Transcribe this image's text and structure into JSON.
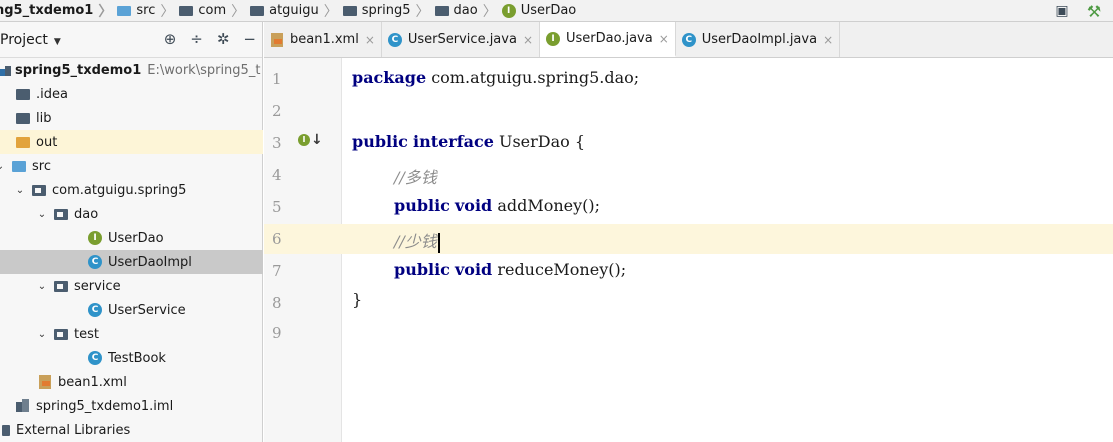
{
  "breadcrumb": [
    {
      "label": "ng5_txdemo1",
      "icon": "folder-icon"
    },
    {
      "label": "src",
      "icon": "folder-icon"
    },
    {
      "label": "com",
      "icon": "folder-icon"
    },
    {
      "label": "atguigu",
      "icon": "folder-icon"
    },
    {
      "label": "spring5",
      "icon": "folder-icon"
    },
    {
      "label": "dao",
      "icon": "folder-icon"
    },
    {
      "label": "UserDao",
      "icon": "interface-icon"
    }
  ],
  "project": {
    "title": "Project",
    "tree": [
      {
        "label": "spring5_txdemo1",
        "path": "E:\\work\\spring5_t"
      },
      {
        "label": ".idea"
      },
      {
        "label": "lib"
      },
      {
        "label": "out"
      },
      {
        "label": "src"
      },
      {
        "label": "com.atguigu.spring5"
      },
      {
        "label": "dao"
      },
      {
        "label": "UserDao"
      },
      {
        "label": "UserDaoImpl"
      },
      {
        "label": "service"
      },
      {
        "label": "UserService"
      },
      {
        "label": "test"
      },
      {
        "label": "TestBook"
      },
      {
        "label": "bean1.xml"
      },
      {
        "label": "spring5_txdemo1.iml"
      },
      {
        "label": "External Libraries"
      }
    ]
  },
  "tabs": [
    {
      "label": "bean1.xml"
    },
    {
      "label": "UserService.java"
    },
    {
      "label": "UserDao.java"
    },
    {
      "label": "UserDaoImpl.java"
    }
  ],
  "editor": {
    "line_numbers": [
      "1",
      "2",
      "3",
      "4",
      "5",
      "6",
      "7",
      "8",
      "9"
    ],
    "code": {
      "l1_kw": "package",
      "l1_rest": " com.atguigu.spring5.dao;",
      "l3_kw1": "public",
      "l3_kw2": "interface",
      "l3_rest": " UserDao {",
      "l4_comment": "//多钱",
      "l5_kw1": "public",
      "l5_kw2": "void",
      "l5_rest": " addMoney();",
      "l6_comment": "//少钱",
      "l7_kw1": "public",
      "l7_kw2": "void",
      "l7_rest": " reduceMoney();",
      "l8": "}"
    }
  },
  "colors": {
    "keyword": "#000080",
    "comment": "#8c8c8c",
    "current_line": "#fdf6dc",
    "selected_row": "#c9c9c9"
  }
}
